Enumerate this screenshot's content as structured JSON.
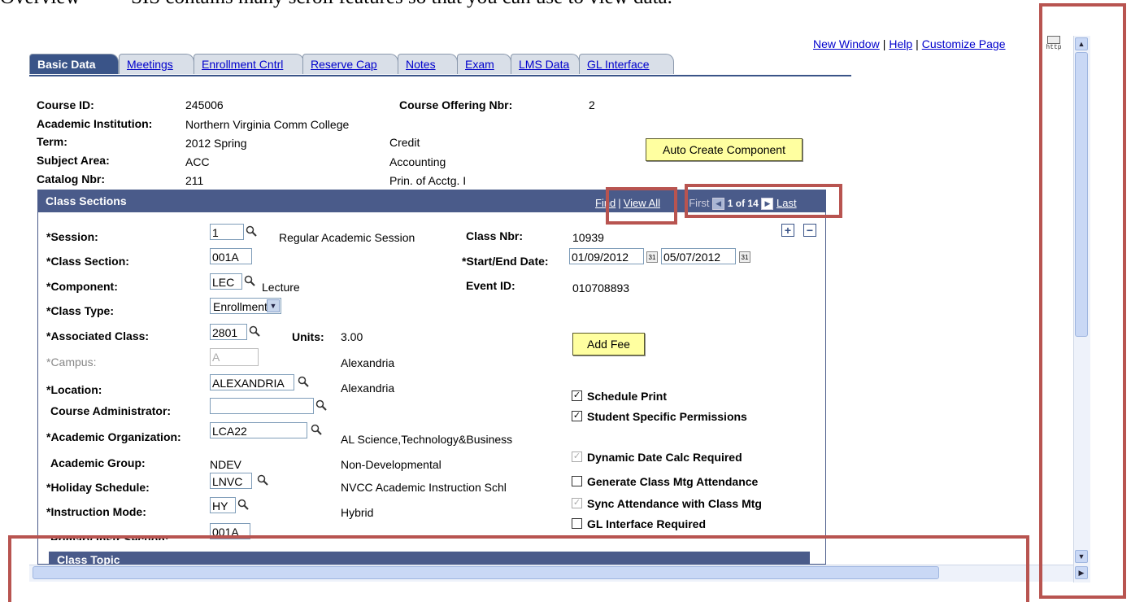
{
  "doc": {
    "heading": "Overview          SIS contains many scroll features so that you can use to view data."
  },
  "toplinks": {
    "new_window": "New Window",
    "help": "Help",
    "customize": "Customize Page",
    "sep": "|",
    "http_icon_text": "http"
  },
  "tabs": [
    {
      "label": "Basic Data"
    },
    {
      "label": "Meetings"
    },
    {
      "label": "Enrollment Cntrl"
    },
    {
      "label": "Reserve Cap"
    },
    {
      "label": "Notes"
    },
    {
      "label": "Exam"
    },
    {
      "label": "LMS Data"
    },
    {
      "label": "GL Interface"
    }
  ],
  "header": {
    "course_id_label": "Course ID:",
    "course_id": "245006",
    "offering_label": "Course Offering Nbr:",
    "offering": "2",
    "institution_label": "Academic Institution:",
    "institution": "Northern Virginia Comm College",
    "term_label": "Term:",
    "term": "2012 Spring",
    "credit": "Credit",
    "subject_label": "Subject Area:",
    "subject": "ACC",
    "subject_desc": "Accounting",
    "catalog_label": "Catalog Nbr:",
    "catalog": "211",
    "catalog_desc": "Prin. of Acctg. I",
    "auto_create": "Auto Create Component"
  },
  "class_sections": {
    "title": "Class Sections",
    "find": "Find",
    "view_all": "View All",
    "sep": "|",
    "first": "First",
    "counter": "1 of 14",
    "last": "Last",
    "fields": {
      "session_label": "*Session:",
      "session": "1",
      "session_desc": "Regular Academic Session",
      "class_nbr_label": "Class Nbr:",
      "class_nbr": "10939",
      "section_label": "*Class Section:",
      "section": "001A",
      "start_end_label": "*Start/End Date:",
      "start_date": "01/09/2012",
      "end_date": "05/07/2012",
      "component_label": "*Component:",
      "component": "LEC",
      "component_desc": "Lecture",
      "event_label": "Event ID:",
      "event": "010708893",
      "class_type_label": "*Class Type:",
      "class_type": "Enrollment",
      "assoc_label": "*Associated Class:",
      "assoc": "2801",
      "units_label": "Units:",
      "units": "3.00",
      "add_fee": "Add Fee",
      "campus_label": "*Campus:",
      "campus": "A",
      "campus_desc": "Alexandria",
      "location_label": "*Location:",
      "location": "ALEXANDRIA",
      "location_desc": "Alexandria",
      "admin_label": "Course Administrator:",
      "admin": "",
      "acad_org_label": "*Academic Organization:",
      "acad_org": "LCA22",
      "acad_org_desc": "AL Science,Technology&Business",
      "acad_group_label": "Academic Group:",
      "acad_group": "NDEV",
      "acad_group_desc": "Non-Developmental",
      "holiday_label": "*Holiday Schedule:",
      "holiday": "LNVC",
      "holiday_desc": "NVCC Academic Instruction Schl",
      "instr_mode_label": "*Instruction Mode:",
      "instr_mode": "HY",
      "instr_mode_desc": "Hybrid",
      "primary_label": "Primary Instr Section:",
      "primary": "001A"
    },
    "checkboxes": [
      {
        "label": "Schedule Print",
        "checked": "✓"
      },
      {
        "label": "Student Specific Permissions",
        "checked": "✓"
      },
      {
        "label": "Dynamic Date Calc Required",
        "checked": "✓"
      },
      {
        "label": "Generate Class Mtg Attendance",
        "checked": ""
      },
      {
        "label": "Sync Attendance with Class Mtg",
        "checked": "✓"
      },
      {
        "label": "GL Interface Required",
        "checked": ""
      }
    ]
  },
  "class_topic": {
    "title": "Class Topic"
  },
  "colors": {
    "header_blue": "#4a5b8a",
    "tab_active": "#3a5488",
    "button_yellow": "#ffffa0",
    "annotation_red": "#b85450"
  },
  "icons": {
    "lookup": "magnifier-icon",
    "calendar": "calendar-icon",
    "add_row": "plus-icon",
    "delete_row": "minus-icon"
  }
}
